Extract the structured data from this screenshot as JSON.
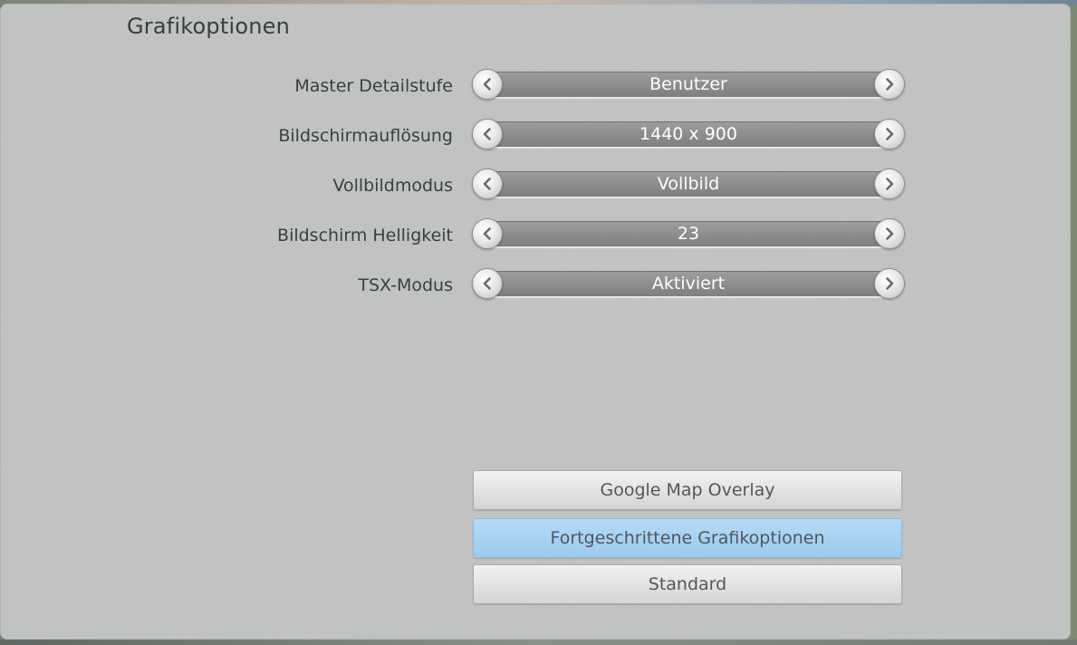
{
  "page": {
    "title": "Grafikoptionen"
  },
  "settings": [
    {
      "label": "Master Detailstufe",
      "value": "Benutzer"
    },
    {
      "label": "Bildschirmauflösung",
      "value": "1440 x 900"
    },
    {
      "label": "Vollbildmodus",
      "value": "Vollbild"
    },
    {
      "label": "Bildschirm Helligkeit",
      "value": "23"
    },
    {
      "label": "TSX-Modus",
      "value": "Aktiviert"
    }
  ],
  "buttons": {
    "google_map_overlay": "Google Map Overlay",
    "advanced_graphics": "Fortgeschrittene Grafikoptionen",
    "standard": "Standard"
  },
  "icons": {
    "previous": "chevron-left-icon",
    "next": "chevron-right-icon"
  },
  "colors": {
    "panel": "#c2c4c3",
    "stepper_track": "#8f8f8f",
    "selected_button": "#a7d1f1",
    "text": "#3b3e40"
  }
}
